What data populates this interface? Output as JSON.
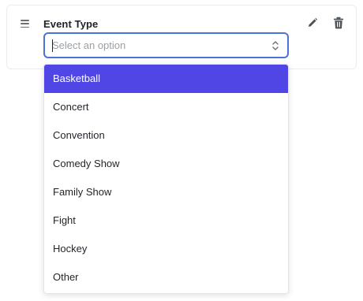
{
  "field": {
    "label": "Event Type",
    "placeholder": "Select an option",
    "value": ""
  },
  "icons": {
    "drag": "drag-handle-icon",
    "edit": "pencil-icon",
    "delete": "trash-icon",
    "select_chevron": "chevron-up-down-icon"
  },
  "dropdown": {
    "selected_index": 0,
    "options": [
      {
        "label": "Basketball"
      },
      {
        "label": "Concert"
      },
      {
        "label": "Convention"
      },
      {
        "label": "Comedy Show"
      },
      {
        "label": "Family Show"
      },
      {
        "label": "Fight"
      },
      {
        "label": "Hockey"
      },
      {
        "label": "Other"
      }
    ]
  },
  "colors": {
    "highlight": "#4f46e5",
    "focus_border": "#4a73d6"
  }
}
